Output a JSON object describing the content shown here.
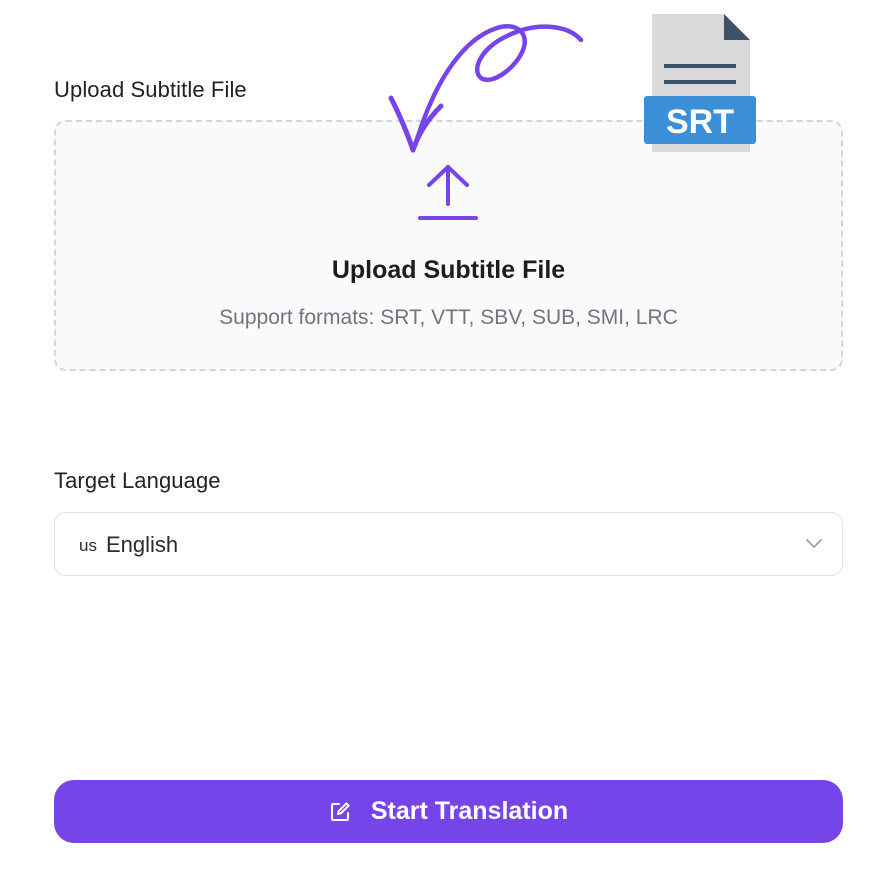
{
  "upload": {
    "section_label": "Upload Subtitle File",
    "title": "Upload Subtitle File",
    "formats_text": "Support formats: SRT, VTT, SBV, SUB, SMI, LRC"
  },
  "language": {
    "section_label": "Target Language",
    "flag": "us",
    "selected": "English"
  },
  "actions": {
    "start_label": "Start Translation"
  },
  "decoration": {
    "file_badge": "SRT"
  },
  "colors": {
    "accent": "#7645ea",
    "file_badge": "#3a8fd6",
    "file_body": "#d9d9d9",
    "file_corner": "#3e5166"
  },
  "icons": [
    "upload-arrow-icon",
    "chevron-down-icon",
    "edit-icon",
    "hand-drawn-arrow-icon",
    "srt-file-icon"
  ]
}
